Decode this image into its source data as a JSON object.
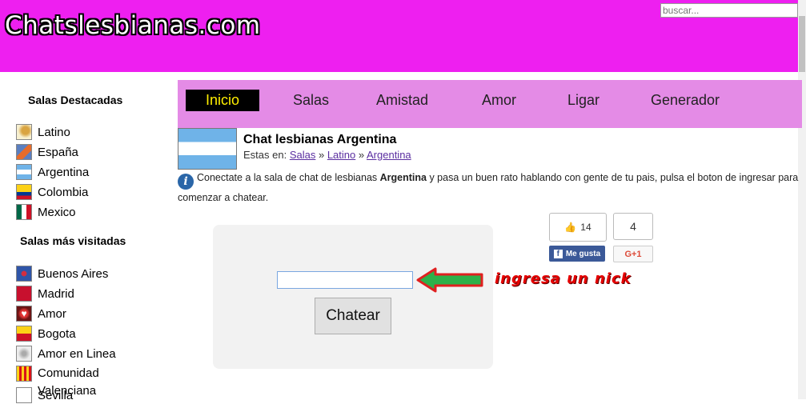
{
  "header": {
    "logo": "Chatslesbianas.com",
    "search_placeholder": "buscar..."
  },
  "sidebar": {
    "featured_title": "Salas Destacadas",
    "featured": [
      {
        "label": "Latino",
        "icon": "latino-flag-icon"
      },
      {
        "label": "España",
        "icon": "spain-flag-icon"
      },
      {
        "label": "Argentina",
        "icon": "argentina-flag-icon"
      },
      {
        "label": "Colombia",
        "icon": "colombia-flag-icon"
      },
      {
        "label": "Mexico",
        "icon": "mexico-flag-icon"
      }
    ],
    "visited_title": "Salas más visitadas",
    "visited": [
      {
        "label": "Buenos Aires",
        "icon": "buenos-aires-flag-icon"
      },
      {
        "label": "Madrid",
        "icon": "madrid-flag-icon"
      },
      {
        "label": "Amor",
        "icon": "heart-icon"
      },
      {
        "label": "Bogota",
        "icon": "bogota-flag-icon"
      },
      {
        "label": "Amor en Linea",
        "icon": "amor-en-linea-icon"
      },
      {
        "label": "Comunidad Valenciana",
        "icon": "valencia-flag-icon"
      },
      {
        "label": "Sevilla",
        "icon": "sevilla-flag-icon"
      }
    ]
  },
  "nav": [
    "Inicio",
    "Salas",
    "Amistad",
    "Amor",
    "Ligar",
    "Generador"
  ],
  "content": {
    "title": "Chat lesbianas Argentina",
    "breadcrumb_prefix": "Estas en:",
    "breadcrumb": [
      "Salas",
      "Latino",
      "Argentina"
    ],
    "desc_before": "Conectate a la sala de chat de lesbianas ",
    "desc_bold": "Argentina",
    "desc_after": " y pasa un buen rato hablando con gente de tu pais, pulsa el boton de ingresar para comenzar a chatear.",
    "nick_value": "",
    "chat_button": "Chatear",
    "hint": "ingresa un nick"
  },
  "social": {
    "fb_count": "14",
    "fb_label": "Me gusta",
    "g_count": "4",
    "g_label": "G+1"
  },
  "colors": {
    "header": "#ee1ff0",
    "nav": "#e48be6",
    "nav_active_text": "#ffee00",
    "hint": "#e60000",
    "arrow": "#2db14a"
  }
}
